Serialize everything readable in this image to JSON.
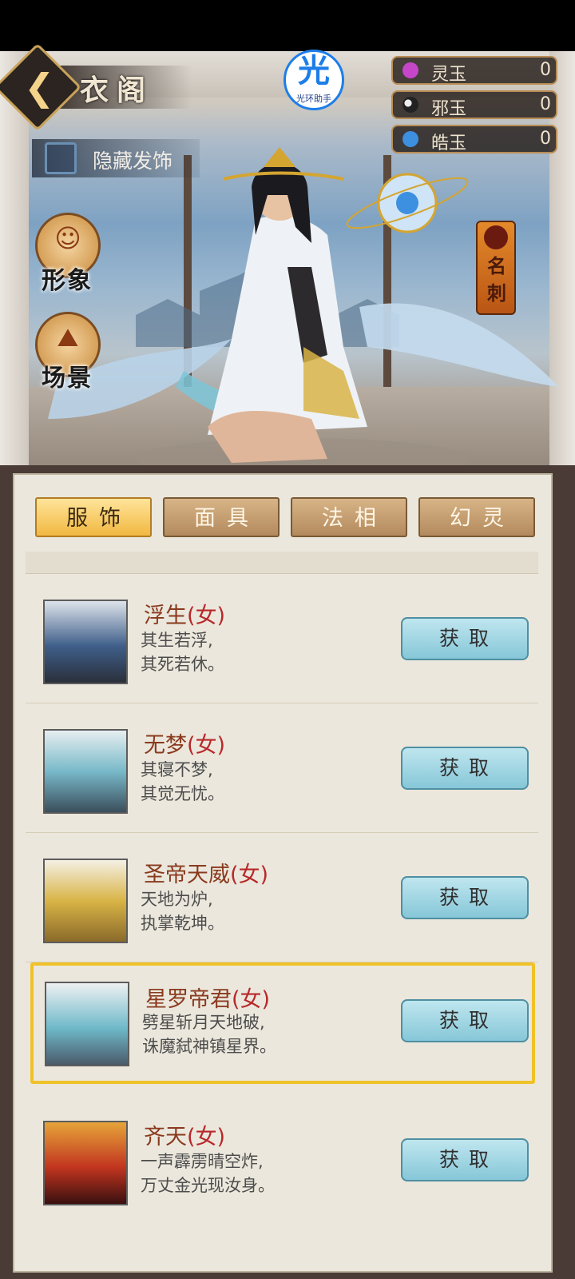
{
  "header": {
    "title": "衣阁",
    "back_icon": "chevron-left-icon"
  },
  "overlay_logo": {
    "big": "光",
    "small": "光环助手"
  },
  "currencies": [
    {
      "name": "灵玉",
      "value": "0",
      "icon": "purple-gem-icon",
      "color": "#c646c9"
    },
    {
      "name": "邪玉",
      "value": "0",
      "icon": "yin-yang-icon",
      "color": "#222222"
    },
    {
      "name": "皓玉",
      "value": "0",
      "icon": "blue-orb-icon",
      "color": "#3d8fe0"
    }
  ],
  "hide_hair": {
    "label": "隐藏发饰",
    "checked": false
  },
  "side_buttons": [
    {
      "label": "形象",
      "icon": "portrait-icon"
    },
    {
      "label": "场景",
      "icon": "mountain-icon"
    }
  ],
  "thorn_tag": {
    "text": "名刺"
  },
  "tabs": [
    {
      "label": "服饰",
      "active": true
    },
    {
      "label": "面具",
      "active": false
    },
    {
      "label": "法相",
      "active": false
    },
    {
      "label": "幻灵",
      "active": false
    }
  ],
  "items": [
    {
      "name": "浮生",
      "sex": "(女)",
      "desc1": "其生若浮,",
      "desc2": "其死若休。",
      "button": "获取",
      "colors": [
        "#3f5f8a",
        "#dde3ea"
      ]
    },
    {
      "name": "无梦",
      "sex": "(女)",
      "desc1": "其寝不梦,",
      "desc2": "其觉无忧。",
      "button": "获取",
      "colors": [
        "#78b9c9",
        "#3b4e5c"
      ]
    },
    {
      "name": "圣帝天威",
      "sex": "(女)",
      "desc1": "天地为炉,",
      "desc2": "执掌乾坤。",
      "button": "获取",
      "colors": [
        "#d9b446",
        "#f4f0e4"
      ]
    },
    {
      "name": "星罗帝君",
      "sex": "(女)",
      "desc1": "劈星斩月天地破,",
      "desc2": "诛魔弑神镇星界。",
      "button": "获取",
      "colors": [
        "#6fb9c9",
        "#eef1f2"
      ],
      "selected": true
    },
    {
      "name": "齐天",
      "sex": "(女)",
      "desc1": "一声霹雳晴空炸,",
      "desc2": "万丈金光现汝身。",
      "button": "获取",
      "colors": [
        "#c2351f",
        "#e6a43a"
      ]
    }
  ]
}
